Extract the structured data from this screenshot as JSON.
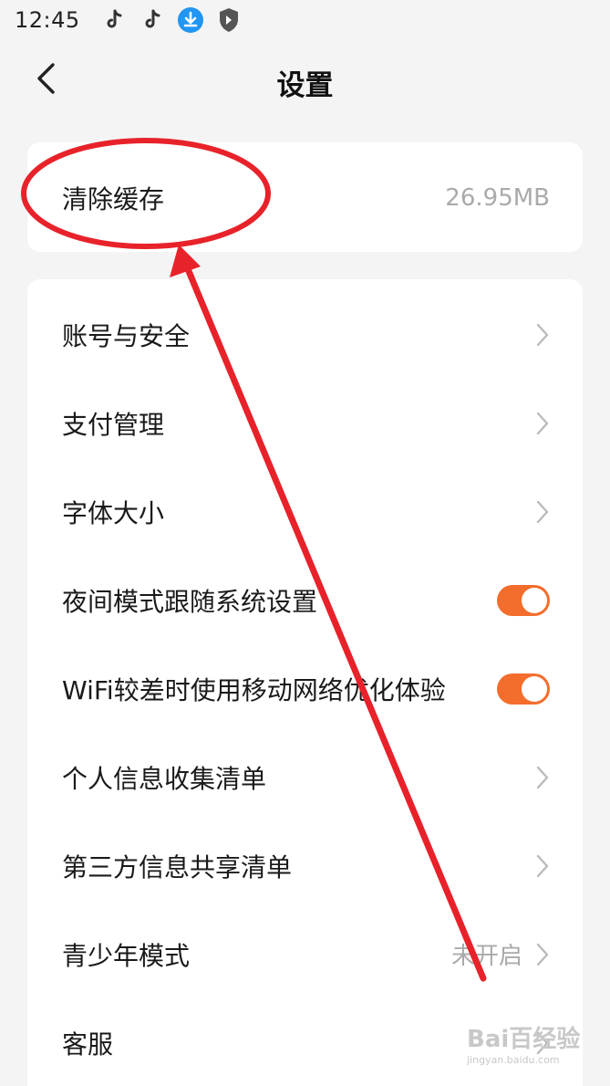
{
  "status_bar": {
    "time": "12:45",
    "icons": [
      "tiktok-icon",
      "tiktok-icon",
      "download-icon",
      "shield-icon"
    ]
  },
  "header": {
    "title": "设置",
    "back_icon": "chevron-left-icon"
  },
  "cache": {
    "label": "清除缓存",
    "value": "26.95MB"
  },
  "settings": {
    "items": [
      {
        "label": "账号与安全",
        "control": "chevron"
      },
      {
        "label": "支付管理",
        "control": "chevron"
      },
      {
        "label": "字体大小",
        "control": "chevron"
      },
      {
        "label": "夜间模式跟随系统设置",
        "control": "toggle",
        "on": true
      },
      {
        "label": "WiFi较差时使用移动网络优化体验",
        "control": "toggle",
        "on": true
      },
      {
        "label": "个人信息收集清单",
        "control": "chevron"
      },
      {
        "label": "第三方信息共享清单",
        "control": "chevron"
      },
      {
        "label": "青少年模式",
        "control": "chevron",
        "value": "未开启"
      },
      {
        "label": "客服",
        "control": "chevron"
      }
    ]
  },
  "colors": {
    "toggle_on": "#f36d2c",
    "annotation": "#e8222a",
    "download_badge": "#2196f3"
  },
  "watermark": {
    "logo": "Bai百经验",
    "url": "jingyan.baidu.com"
  }
}
